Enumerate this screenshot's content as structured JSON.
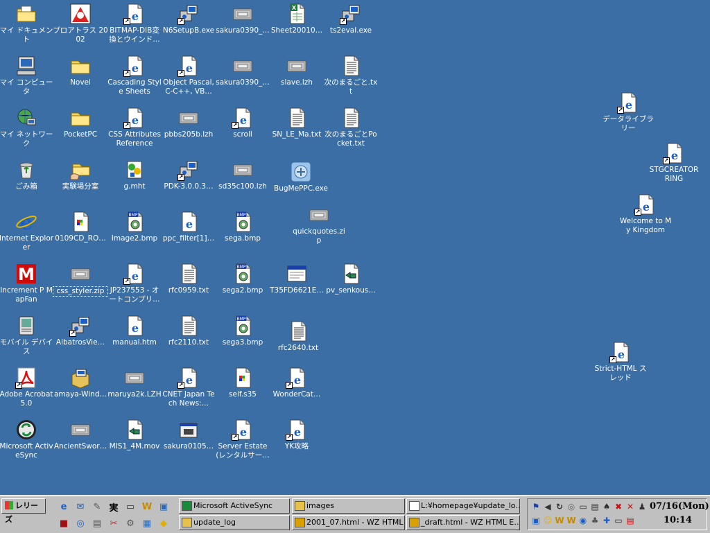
{
  "desktop": {
    "icons": [
      {
        "label": "マイ ドキュメント",
        "icon": "folder-documents-icon"
      },
      {
        "label": "プロアトラス 2002",
        "icon": "proatlas-app-icon"
      },
      {
        "label": "BITMAP-DIB変換とウインド…",
        "icon": "ie-shortcut-icon"
      },
      {
        "label": "N6SetupB.exe",
        "icon": "installer-icon"
      },
      {
        "label": "sakura0390_…",
        "icon": "archive-icon"
      },
      {
        "label": "Sheet20010…",
        "icon": "excel-icon"
      },
      {
        "label": "ts2eval.exe",
        "icon": "installer-icon"
      },
      {
        "label": "マイ コンピュータ",
        "icon": "my-computer-icon"
      },
      {
        "label": "Novel",
        "icon": "folder-icon"
      },
      {
        "label": "Cascading Style Sheets",
        "icon": "ie-shortcut-icon"
      },
      {
        "label": "Object Pascal, C-C++, VB…",
        "icon": "ie-shortcut-icon"
      },
      {
        "label": "sakura0390_…",
        "icon": "archive-icon"
      },
      {
        "label": "slave.lzh",
        "icon": "archive-icon"
      },
      {
        "label": "次のまるごと.txt",
        "icon": "text-file-icon"
      },
      {
        "label": "マイ ネットワーク",
        "icon": "network-icon"
      },
      {
        "label": "PocketPC",
        "icon": "folder-icon"
      },
      {
        "label": "CSS Attributes Reference",
        "icon": "ie-shortcut-icon"
      },
      {
        "label": "pbbs205b.lzh",
        "icon": "archive-icon"
      },
      {
        "label": "scroll",
        "icon": "ie-shortcut-icon"
      },
      {
        "label": "SN_LE_Ma.txt",
        "icon": "text-file-icon"
      },
      {
        "label": "次のまるごとPocket.txt",
        "icon": "text-file-icon"
      },
      {
        "label": "ごみ箱",
        "icon": "recycle-bin-icon"
      },
      {
        "label": "実験場分室",
        "icon": "shared-folder-icon"
      },
      {
        "label": "g.mht",
        "icon": "mht-file-icon"
      },
      {
        "label": "PDK-3.0.0.3…",
        "icon": "installer-icon"
      },
      {
        "label": "sd35c100.lzh",
        "icon": "archive-icon"
      },
      {
        "label": "BugMePPC.exe",
        "icon": "bugme-app-icon"
      },
      {
        "label": "Internet Explorer",
        "icon": "internet-explorer-icon"
      },
      {
        "label": "0109CD_RO…",
        "icon": "generic-file-icon"
      },
      {
        "label": "Image2.bmp",
        "icon": "bmp-file-icon"
      },
      {
        "label": "ppc_filter[1]…",
        "icon": "ie-document-icon"
      },
      {
        "label": "sega.bmp",
        "icon": "bmp-file-icon"
      },
      {
        "label": "quickquotes.zip",
        "icon": "archive-icon"
      },
      {
        "label": "Increment P MapFan",
        "icon": "mapfan-app-icon"
      },
      {
        "label": "css_styler.zip",
        "icon": "archive-icon",
        "selected": true
      },
      {
        "label": "JP237553 - オートコンプリ…",
        "icon": "ie-shortcut-icon"
      },
      {
        "label": "rfc0959.txt",
        "icon": "text-file-icon"
      },
      {
        "label": "sega2.bmp",
        "icon": "bmp-file-icon"
      },
      {
        "label": "T35FD6621E…",
        "icon": "window-file-icon"
      },
      {
        "label": "pv_senkous…",
        "icon": "video-file-icon"
      },
      {
        "label": "モバイル デバイス",
        "icon": "mobile-device-icon"
      },
      {
        "label": "AlbatrosVie…",
        "icon": "installer-icon"
      },
      {
        "label": "manual.htm",
        "icon": "ie-document-icon"
      },
      {
        "label": "rfc2110.txt",
        "icon": "text-file-icon"
      },
      {
        "label": "sega3.bmp",
        "icon": "bmp-file-icon"
      },
      {
        "label": "rfc2640.txt",
        "icon": "text-file-icon"
      },
      {
        "label": "Adobe Acrobat 5.0",
        "icon": "acrobat-icon"
      },
      {
        "label": "amaya-Wind…",
        "icon": "installer-box-icon"
      },
      {
        "label": "maruya2k.LZH",
        "icon": "archive-icon"
      },
      {
        "label": "CNET Japan Tech News:…",
        "icon": "ie-shortcut-icon"
      },
      {
        "label": "self.s35",
        "icon": "generic-file-icon"
      },
      {
        "label": "WonderCat…",
        "icon": "ie-shortcut-icon"
      },
      {
        "label": "Microsoft ActiveSync",
        "icon": "activesync-icon"
      },
      {
        "label": "AncientSwor…",
        "icon": "archive-icon"
      },
      {
        "label": "MIS1_4M.mov",
        "icon": "video-file-icon"
      },
      {
        "label": "sakura0105…",
        "icon": "executable-icon"
      },
      {
        "label": "Server Estate(レンタルサー…",
        "icon": "ie-shortcut-icon"
      },
      {
        "label": "YK攻略",
        "icon": "ie-shortcut-icon"
      },
      {
        "label": "データライブラリー",
        "icon": "ie-shortcut-icon"
      },
      {
        "label": "STGCREATOR RING",
        "icon": "ie-shortcut-icon"
      },
      {
        "label": "Welcome to My Kingdom",
        "icon": "ie-shortcut-icon"
      },
      {
        "label": "Strict-HTML スレッド",
        "icon": "ie-shortcut-icon"
      }
    ]
  },
  "taskbar": {
    "start_label": "レリーズ",
    "tasks": [
      {
        "label": "Microsoft ActiveSync",
        "icon": "activesync-icon"
      },
      {
        "label": "images",
        "icon": "folder-icon"
      },
      {
        "label": "L:¥homepage¥update_lo…",
        "icon": "text-file-icon"
      },
      {
        "label": "update_log",
        "icon": "folder-icon"
      },
      {
        "label": "2001_07.html - WZ HTML …",
        "icon": "wz-editor-icon"
      },
      {
        "label": "_draft.html - WZ HTML E…",
        "icon": "wz-editor-icon"
      }
    ],
    "quicklaunch": [
      {
        "icon": "internet-explorer-icon",
        "text": "e"
      },
      {
        "icon": "outlook-icon",
        "text": "✉"
      },
      {
        "icon": "notepad-icon",
        "text": "✎"
      },
      {
        "icon": "kanji-tool-icon",
        "text": "実"
      },
      {
        "icon": "window-icon",
        "text": "▭"
      },
      {
        "icon": "wz-editor-icon",
        "text": "W"
      },
      {
        "icon": "image-viewer-icon",
        "text": "▣"
      },
      {
        "icon": "book-icon",
        "text": "■"
      },
      {
        "icon": "globe-icon",
        "text": "◎"
      },
      {
        "icon": "document-icon",
        "text": "▤"
      },
      {
        "icon": "tools-icon",
        "text": "✂"
      },
      {
        "icon": "settings-icon",
        "text": "⚙"
      },
      {
        "icon": "photo-icon",
        "text": "▦"
      },
      {
        "icon": "warning-icon",
        "text": "◆"
      }
    ],
    "tray": [
      {
        "icon": "tray-flag-icon",
        "text": "⚑"
      },
      {
        "icon": "volume-icon",
        "text": "◀"
      },
      {
        "icon": "network-tray-icon",
        "text": "↻"
      },
      {
        "icon": "disk-icon",
        "text": "◎"
      },
      {
        "icon": "monitor-icon",
        "text": "▭"
      },
      {
        "icon": "keyboard-icon",
        "text": "▤"
      },
      {
        "icon": "hat-icon",
        "text": "♠"
      },
      {
        "icon": "close-x-icon",
        "text": "✖"
      },
      {
        "icon": "wrench-icon",
        "text": "✕"
      },
      {
        "icon": "person-icon",
        "text": "♟"
      },
      {
        "icon": "image-tray-icon",
        "text": "▣"
      },
      {
        "icon": "smiley-icon",
        "text": "☺"
      },
      {
        "icon": "wz-tray-icon",
        "text": "W"
      },
      {
        "icon": "wz-tray-icon-2",
        "text": "W"
      },
      {
        "icon": "eye-icon",
        "text": "◉"
      },
      {
        "icon": "dog-icon",
        "text": "♣"
      },
      {
        "icon": "puzzle-icon",
        "text": "✚"
      },
      {
        "icon": "window-tray-icon",
        "text": "▭"
      },
      {
        "icon": "printer-error-icon",
        "text": "▤"
      }
    ],
    "clock": {
      "date": "07/16(Mon)",
      "time": "10:14"
    }
  },
  "colors": {
    "desktop": "#3a6ea5",
    "taskbar": "#c0c0c0",
    "ie_blue": "#1a5fc8"
  }
}
